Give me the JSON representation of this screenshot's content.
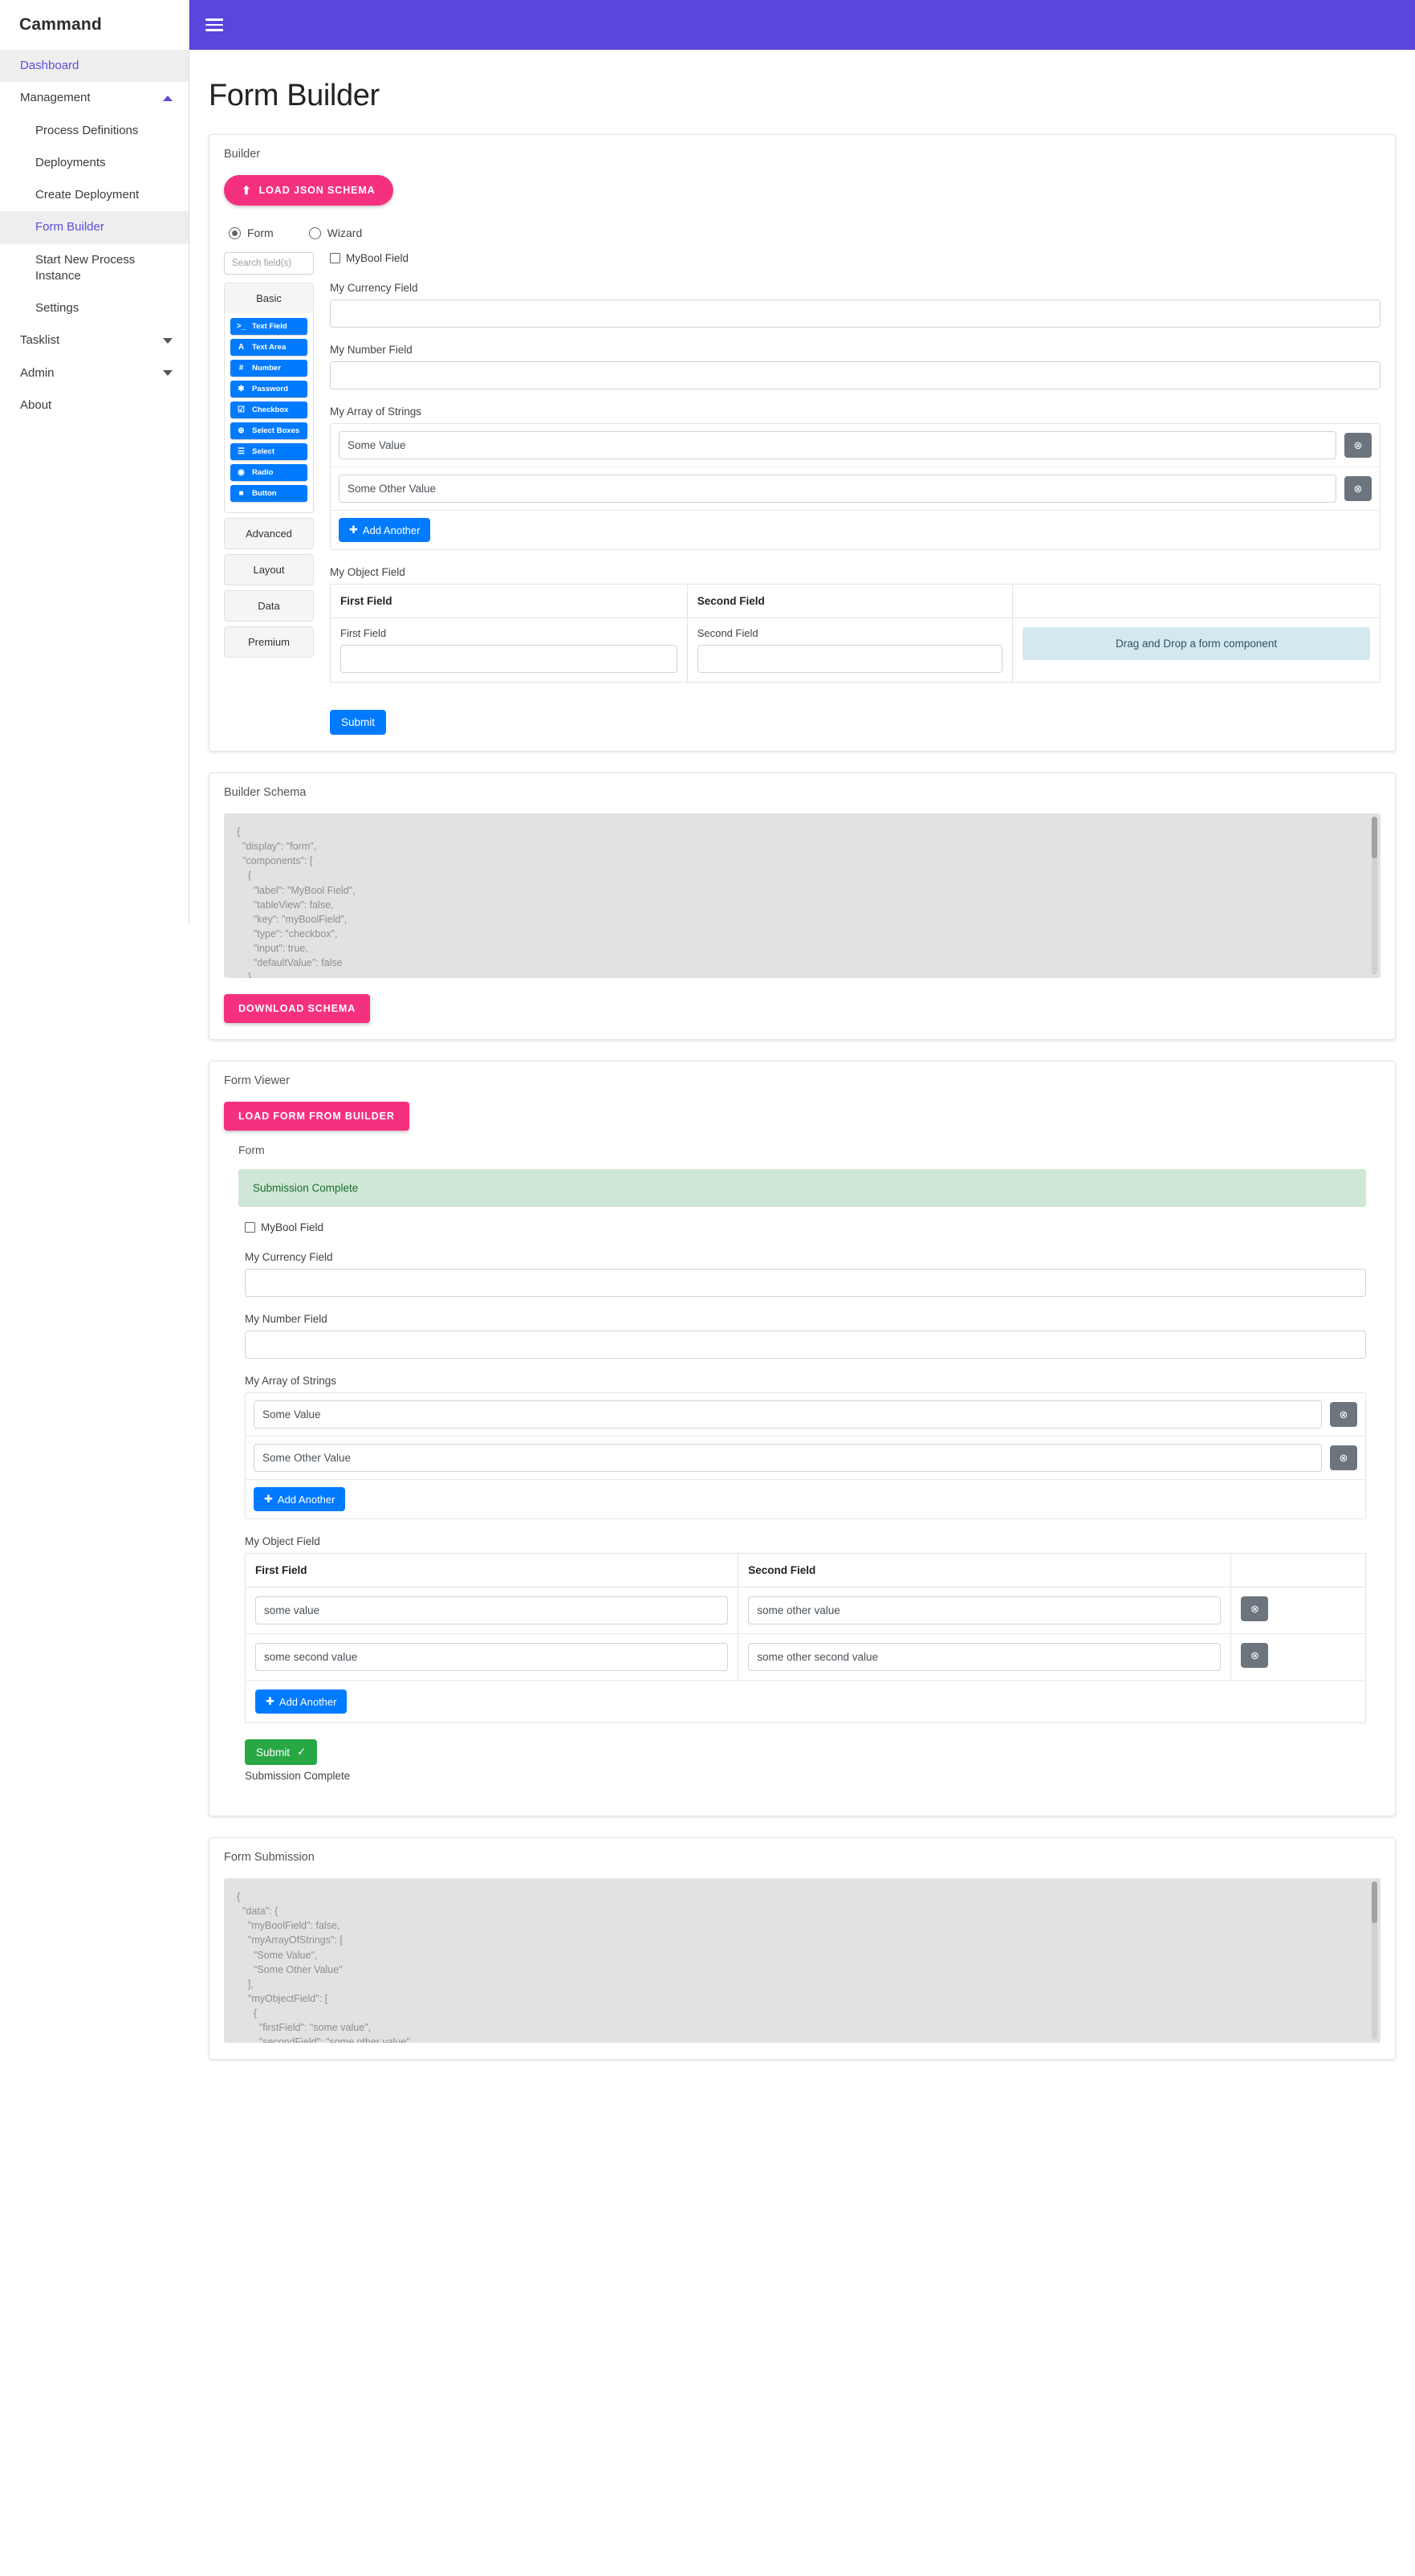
{
  "brand": "Cammand",
  "sidebar": {
    "items": [
      {
        "label": "Dashboard",
        "type": "link",
        "active": true
      },
      {
        "label": "Management",
        "type": "group",
        "caret": "up"
      },
      {
        "label": "Process Definitions",
        "type": "sub"
      },
      {
        "label": "Deployments",
        "type": "sub"
      },
      {
        "label": "Create Deployment",
        "type": "sub"
      },
      {
        "label": "Form Builder",
        "type": "sub",
        "active": true
      },
      {
        "label": "Start New Process Instance",
        "type": "sub"
      },
      {
        "label": "Settings",
        "type": "sub"
      },
      {
        "label": "Tasklist",
        "type": "group",
        "caret": "down"
      },
      {
        "label": "Admin",
        "type": "group",
        "caret": "down"
      },
      {
        "label": "About",
        "type": "plain"
      }
    ]
  },
  "topbar": {
    "menu_icon": "hamburger-icon"
  },
  "page": {
    "title": "Form Builder"
  },
  "builder": {
    "section_label": "Builder",
    "load_button": "LOAD JSON SCHEMA",
    "load_icon": "upload-icon",
    "display_options": [
      {
        "label": "Form",
        "selected": true
      },
      {
        "label": "Wizard",
        "selected": false
      }
    ],
    "search_placeholder": "Search field(s)",
    "search_value": "",
    "groups": [
      {
        "name": "Basic",
        "expanded": true,
        "components": [
          {
            "label": "Text Field",
            "icon": ">_"
          },
          {
            "label": "Text Area",
            "icon": "A"
          },
          {
            "label": "Number",
            "icon": "#"
          },
          {
            "label": "Password",
            "icon": "✱"
          },
          {
            "label": "Checkbox",
            "icon": "☑"
          },
          {
            "label": "Select Boxes",
            "icon": "⊕"
          },
          {
            "label": "Select",
            "icon": "☰"
          },
          {
            "label": "Radio",
            "icon": "◉"
          },
          {
            "label": "Button",
            "icon": "■"
          }
        ]
      },
      {
        "name": "Advanced",
        "expanded": false,
        "components": []
      },
      {
        "name": "Layout",
        "expanded": false,
        "components": []
      },
      {
        "name": "Data",
        "expanded": false,
        "components": []
      },
      {
        "name": "Premium",
        "expanded": false,
        "components": []
      }
    ],
    "form": {
      "bool_label": "MyBool Field",
      "bool_checked": false,
      "currency_label": "My Currency Field",
      "currency_value": "",
      "number_label": "My Number Field",
      "number_value": "",
      "array_label": "My Array of Strings",
      "array_values": [
        "Some Value",
        "Some Other Value"
      ],
      "add_another": "Add Another",
      "object_label": "My Object Field",
      "object_headers": [
        "First Field",
        "Second Field",
        ""
      ],
      "object_row": {
        "first_label": "First Field",
        "first_value": "",
        "second_label": "Second Field",
        "second_value": "",
        "dropzone": "Drag and Drop a form component"
      },
      "submit_label": "Submit"
    }
  },
  "builder_schema": {
    "section_label": "Builder Schema",
    "code": "{\n  \"display\": \"form\",\n  \"components\": [\n    {\n      \"label\": \"MyBool Field\",\n      \"tableView\": false,\n      \"key\": \"myBoolField\",\n      \"type\": \"checkbox\",\n      \"input\": true,\n      \"defaultValue\": false\n    },",
    "download_button": "DOWNLOAD SCHEMA"
  },
  "form_viewer": {
    "section_label": "Form Viewer",
    "load_button": "LOAD FORM FROM BUILDER",
    "form_label": "Form",
    "alert": "Submission Complete",
    "bool_label": "MyBool Field",
    "bool_checked": false,
    "currency_label": "My Currency Field",
    "currency_value": "",
    "number_label": "My Number Field",
    "number_value": "",
    "array_label": "My Array of Strings",
    "array_values": [
      "Some Value",
      "Some Other Value"
    ],
    "add_another": "Add Another",
    "object_label": "My Object Field",
    "object_headers": [
      "First Field",
      "Second Field",
      ""
    ],
    "object_rows": [
      {
        "first": "some value",
        "second": "some other value"
      },
      {
        "first": "some second value",
        "second": "some other second value"
      }
    ],
    "submit_label": "Submit",
    "submit_icon": "check-icon",
    "submission_status": "Submission Complete"
  },
  "form_submission": {
    "section_label": "Form Submission",
    "code": "{\n  \"data\": {\n    \"myBoolField\": false,\n    \"myArrayOfStrings\": [\n      \"Some Value\",\n      \"Some Other Value\"\n    ],\n    \"myObjectField\": [\n      {\n        \"firstField\": \"some value\",\n        \"secondField\": \"some other value\""
  },
  "colors": {
    "brand_purple": "#5a46dd",
    "accent_pink": "#f5317f",
    "primary_blue": "#007bff",
    "success_green": "#28a745",
    "alert_green_bg": "#cfe8d5",
    "dropzone_blue": "#d4e9ef",
    "remove_gray": "#6c757d"
  },
  "icons": {
    "remove": "⊗",
    "add": "✚",
    "check": "✓",
    "upload": "⬆"
  }
}
